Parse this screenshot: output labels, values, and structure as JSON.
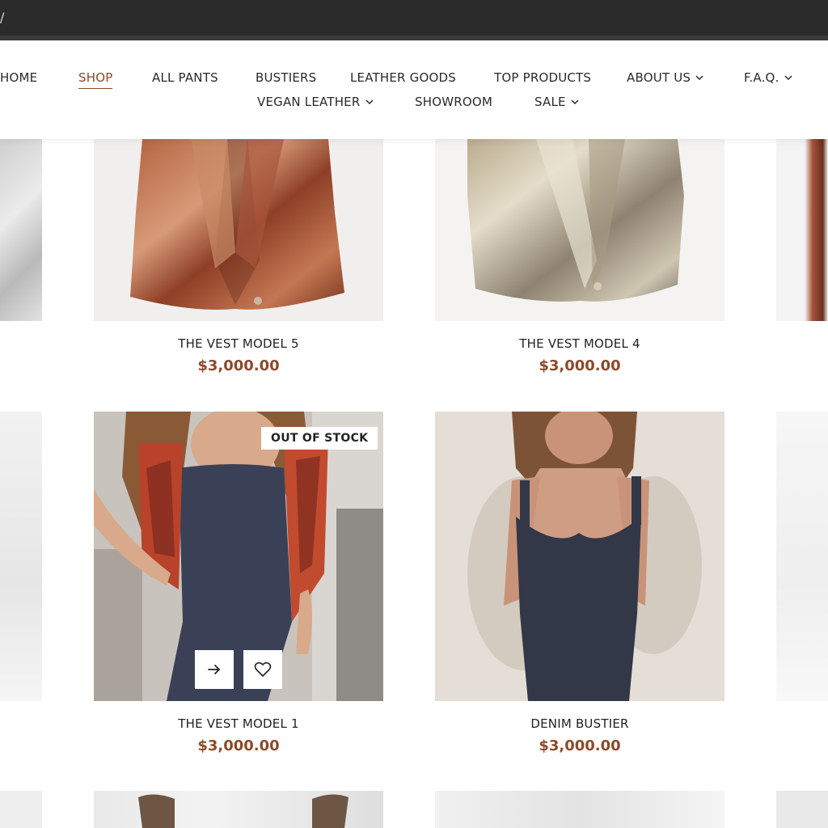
{
  "browser": {
    "url_tail": "/"
  },
  "nav": {
    "home": "HOME",
    "shop": "SHOP",
    "all_pants": "ALL PANTS",
    "bustiers": "BUSTIERS",
    "leather_goods": "LEATHER GOODS",
    "top_products": "TOP PRODUCTS",
    "about_us": "ABOUT US",
    "faq": "F.A.Q.",
    "vegan_leather": "VEGAN LEATHER",
    "showroom": "SHOWROOM",
    "sale": "SALE",
    "active": "SHOP"
  },
  "products": [
    {
      "title": "THE VEST MODEL 5",
      "price": "$3,000.00"
    },
    {
      "title": "THE VEST MODEL 4",
      "price": "$3,000.00"
    },
    {
      "title": "THE VEST MODEL 1",
      "price": "$3,000.00",
      "badge": "OUT OF STOCK"
    },
    {
      "title": "DENIM BUSTIER",
      "price": "$3,000.00"
    }
  ],
  "colors": {
    "accent": "#8b4a2b",
    "header_bg": "#ffffff",
    "browser_bg": "#2b2b2b"
  },
  "icons": {
    "arrow": "arrow-right-icon",
    "wishlist": "heart-icon",
    "chevron": "chevron-down-icon"
  }
}
